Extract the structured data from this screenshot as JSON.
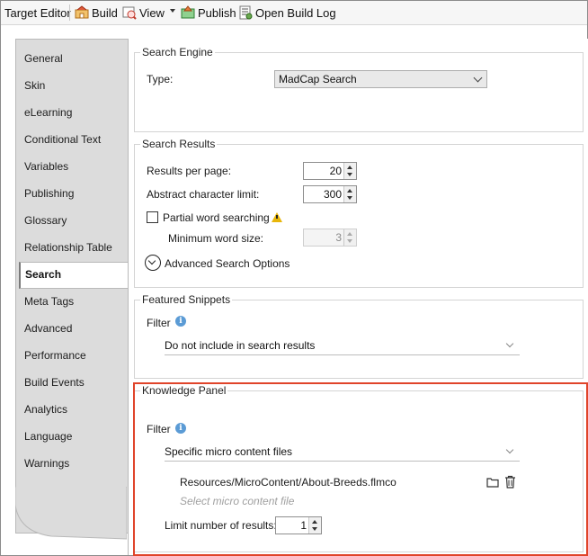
{
  "toolbar": {
    "target_editor": "Target Editor",
    "build": "Build",
    "view": "View",
    "publish": "Publish",
    "open_build_log": "Open Build Log"
  },
  "nav": {
    "items": [
      "General",
      "Skin",
      "eLearning",
      "Conditional Text",
      "Variables",
      "Publishing",
      "Glossary",
      "Relationship Table",
      "Search",
      "Meta Tags",
      "Advanced",
      "Performance",
      "Build Events",
      "Analytics",
      "Language",
      "Warnings"
    ],
    "selected": "Search"
  },
  "search_engine": {
    "title": "Search Engine",
    "type_label": "Type:",
    "type_value": "MadCap Search"
  },
  "search_results": {
    "title": "Search Results",
    "results_per_page_label": "Results per page:",
    "results_per_page": "20",
    "abstract_limit_label": "Abstract character limit:",
    "abstract_limit": "300",
    "partial_word_label": "Partial word searching",
    "min_word_size_label": "Minimum word size:",
    "min_word_size": "3",
    "advanced_options_label": "Advanced Search Options"
  },
  "featured_snippets": {
    "title": "Featured Snippets",
    "filter_label": "Filter",
    "filter_value": "Do not include in search results"
  },
  "knowledge_panel": {
    "title": "Knowledge Panel",
    "filter_label": "Filter",
    "filter_value": "Specific micro content files",
    "file_path": "Resources/MicroContent/About-Breeds.flmco",
    "select_placeholder": "Select micro content file",
    "limit_label": "Limit number of results:",
    "limit_value": "1"
  },
  "colors": {
    "highlight": "#e0442a",
    "info": "#5b9bd5",
    "warning": "#e8b60a"
  }
}
